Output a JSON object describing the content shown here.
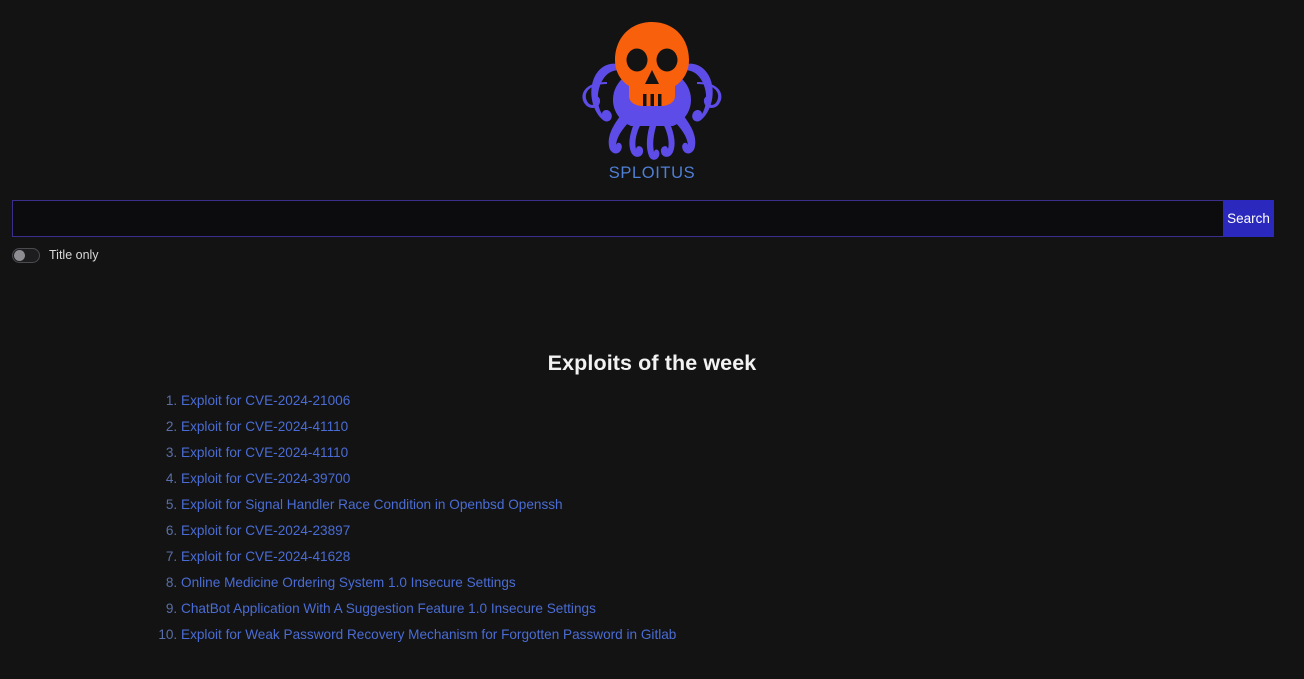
{
  "site": {
    "brand": "SPLOITUS",
    "logo_icon": "cthulhu-skull-octopus-logo",
    "colors": {
      "background": "#131313",
      "skull_orange": "#f8600c",
      "tentacle_purple": "#5e4ce8",
      "brand_text": "#4f7fd6",
      "link": "#4a6cd4",
      "search_button": "#2b29bd",
      "input_border": "#3b2f8e"
    }
  },
  "search": {
    "value": "",
    "placeholder": "",
    "button_label": "Search",
    "title_only_label": "Title only",
    "title_only_enabled": false
  },
  "main": {
    "section_title": "Exploits of the week",
    "exploits": [
      {
        "index": "1",
        "label": "Exploit for CVE-2024-21006"
      },
      {
        "index": "2",
        "label": "Exploit for CVE-2024-41110"
      },
      {
        "index": "3",
        "label": "Exploit for CVE-2024-41110"
      },
      {
        "index": "4",
        "label": "Exploit for CVE-2024-39700"
      },
      {
        "index": "5",
        "label": "Exploit for Signal Handler Race Condition in Openbsd Openssh"
      },
      {
        "index": "6",
        "label": "Exploit for CVE-2024-23897"
      },
      {
        "index": "7",
        "label": "Exploit for CVE-2024-41628"
      },
      {
        "index": "8",
        "label": "Online Medicine Ordering System 1.0 Insecure Settings"
      },
      {
        "index": "9",
        "label": "ChatBot Application With A Suggestion Feature 1.0 Insecure Settings"
      },
      {
        "index": "10",
        "label": "Exploit for Weak Password Recovery Mechanism for Forgotten Password in Gitlab"
      }
    ]
  }
}
